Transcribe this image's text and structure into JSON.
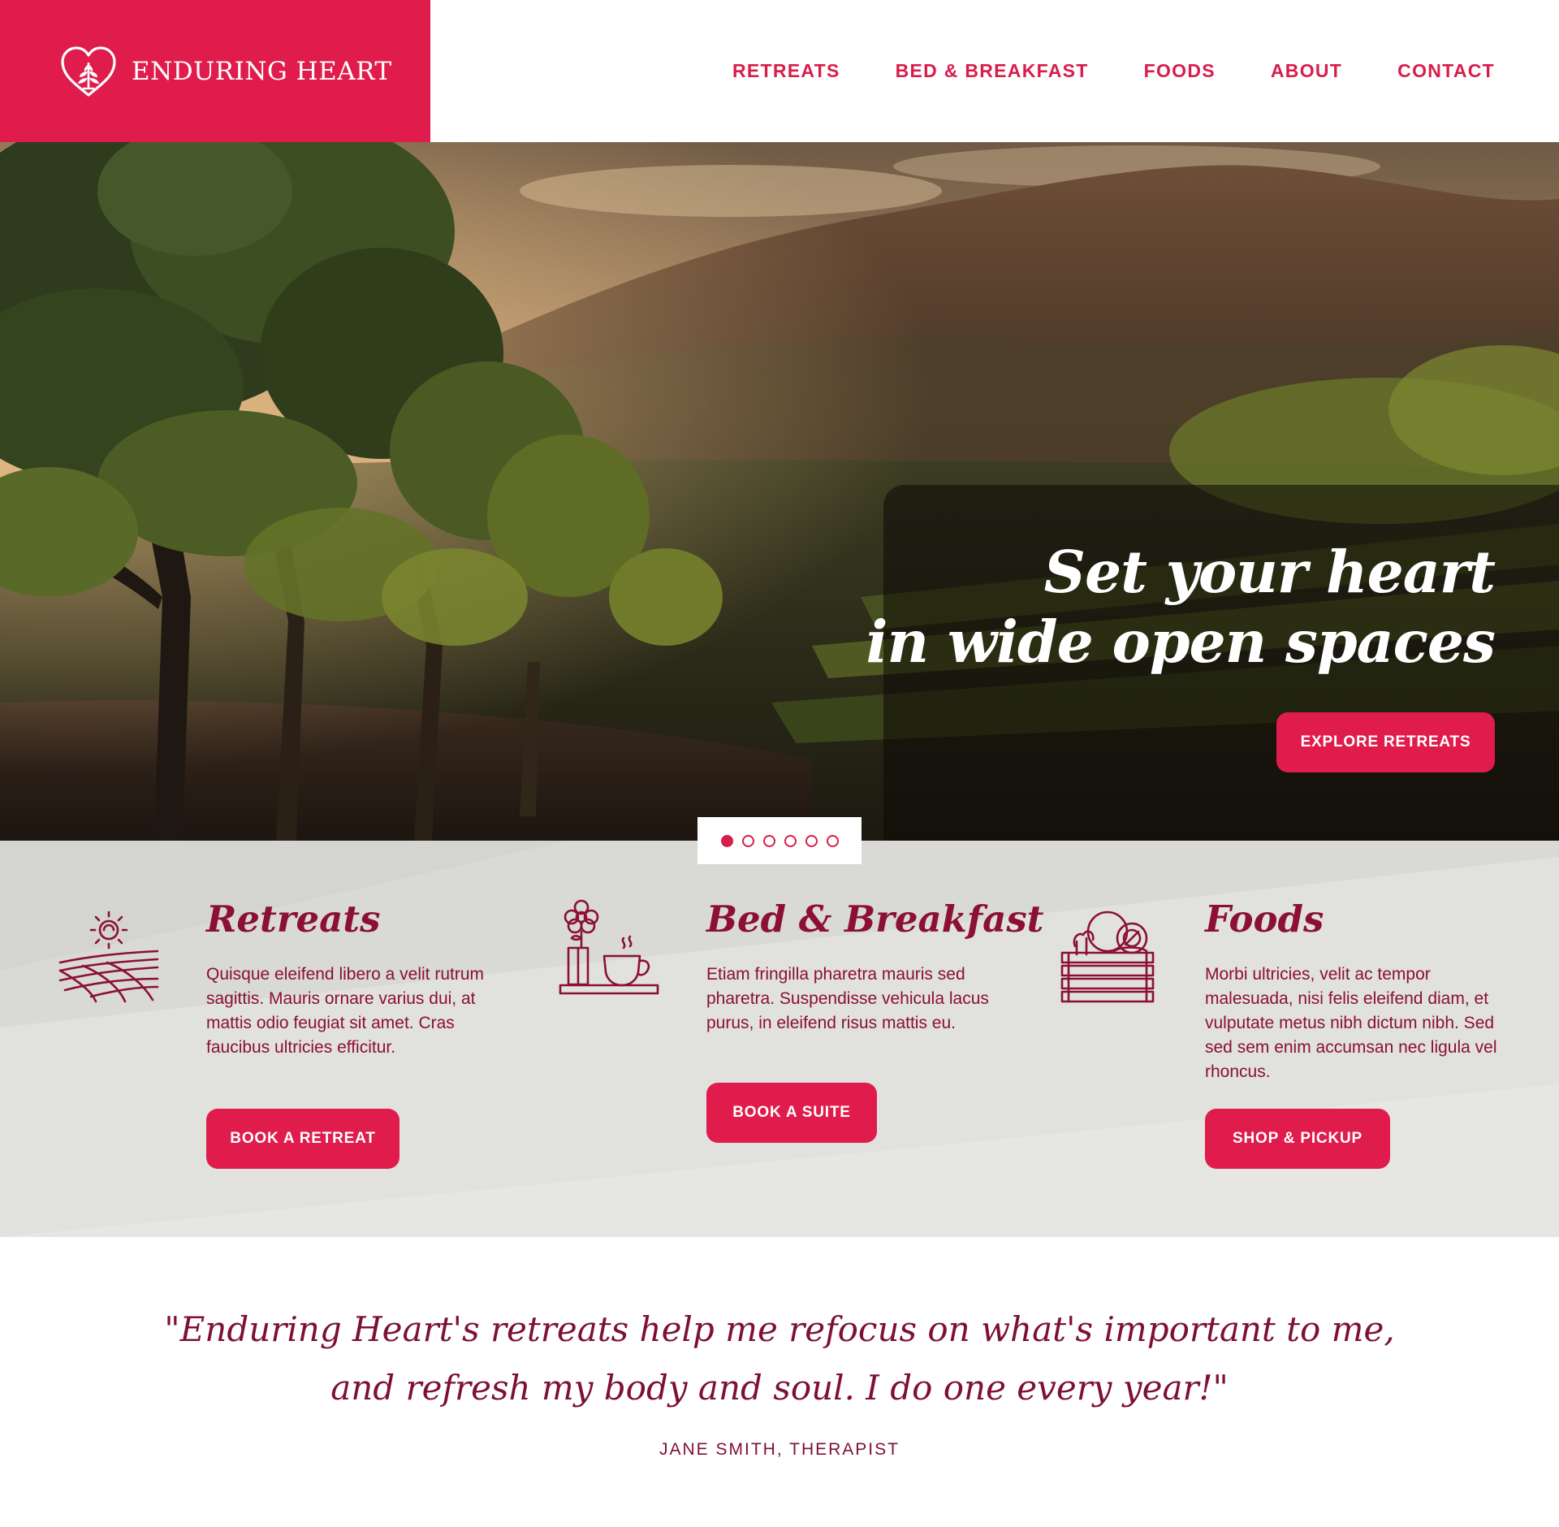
{
  "brand": {
    "name": "ENDURING HEART",
    "logo_icon": "heart-tree-icon",
    "color": "#e01c4c"
  },
  "nav": {
    "items": [
      {
        "label": "RETREATS"
      },
      {
        "label": "BED & BREAKFAST"
      },
      {
        "label": "FOODS"
      },
      {
        "label": "ABOUT"
      },
      {
        "label": "CONTACT"
      }
    ]
  },
  "hero": {
    "title_line1": "Set your heart",
    "title_line2": "in wide open spaces",
    "cta_label": "EXPLORE RETREATS",
    "slides": {
      "total": 6,
      "active": 1
    }
  },
  "features": [
    {
      "title": "Retreats",
      "icon": "sun-over-fields-icon",
      "text": "Quisque eleifend libero a velit rutrum sagittis. Mauris ornare varius dui, at mattis odio feugiat sit amet. Cras faucibus ultricies efficitur.",
      "button": "BOOK A RETREAT"
    },
    {
      "title": "Bed & Breakfast",
      "icon": "flower-and-tea-cup-icon",
      "text": "Etiam fringilla pharetra mauris sed pharetra. Suspendisse vehicula lacus purus, in eleifend risus mattis eu.",
      "button": "BOOK A SUITE"
    },
    {
      "title": "Foods",
      "icon": "produce-crate-icon",
      "text": "Morbi ultricies, velit ac tempor malesuada, nisi felis eleifend diam, et vulputate metus nibh dictum nibh. Sed sed sem enim accumsan nec ligula vel rhoncus.",
      "button": "SHOP & PICKUP"
    }
  ],
  "testimonial": {
    "quote_line1": "\"Enduring Heart's retreats help me refocus on what's important to me,",
    "quote_line2": "and refresh my body and soul. I do one every year!\"",
    "author": "JANE SMITH, THERAPIST"
  },
  "colors": {
    "accent": "#e01c4c",
    "text_dark_red": "#8b1034",
    "features_bg": "#dcdcd8"
  }
}
